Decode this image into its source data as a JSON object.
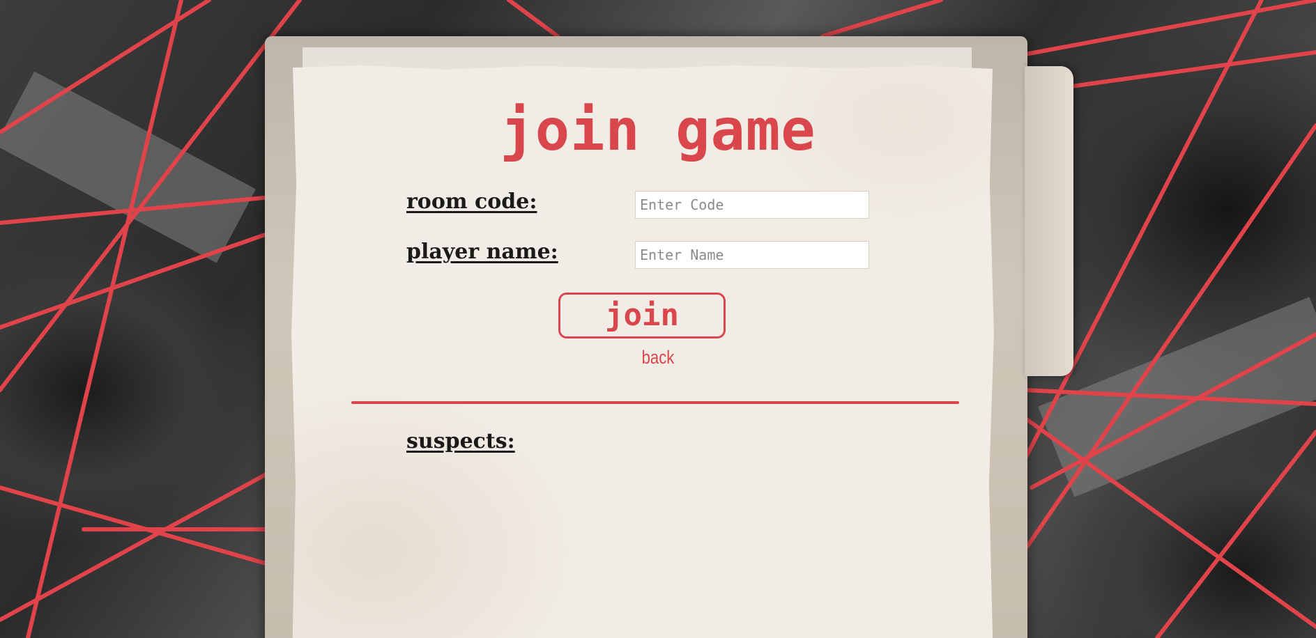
{
  "page": {
    "title": "join game"
  },
  "form": {
    "room_code": {
      "label": "room code:",
      "value": "",
      "placeholder": "Enter Code"
    },
    "player_name": {
      "label": "player name:",
      "value": "",
      "placeholder": "Enter Name"
    },
    "join_label": "join",
    "back_label": "back"
  },
  "suspects": {
    "label": "suspects:",
    "items": []
  },
  "colors": {
    "accent": "#d9474c",
    "paper": "#f1ece6",
    "text": "#1a1a1a"
  },
  "icons": {
    "background": "red-string-evidence-board"
  }
}
